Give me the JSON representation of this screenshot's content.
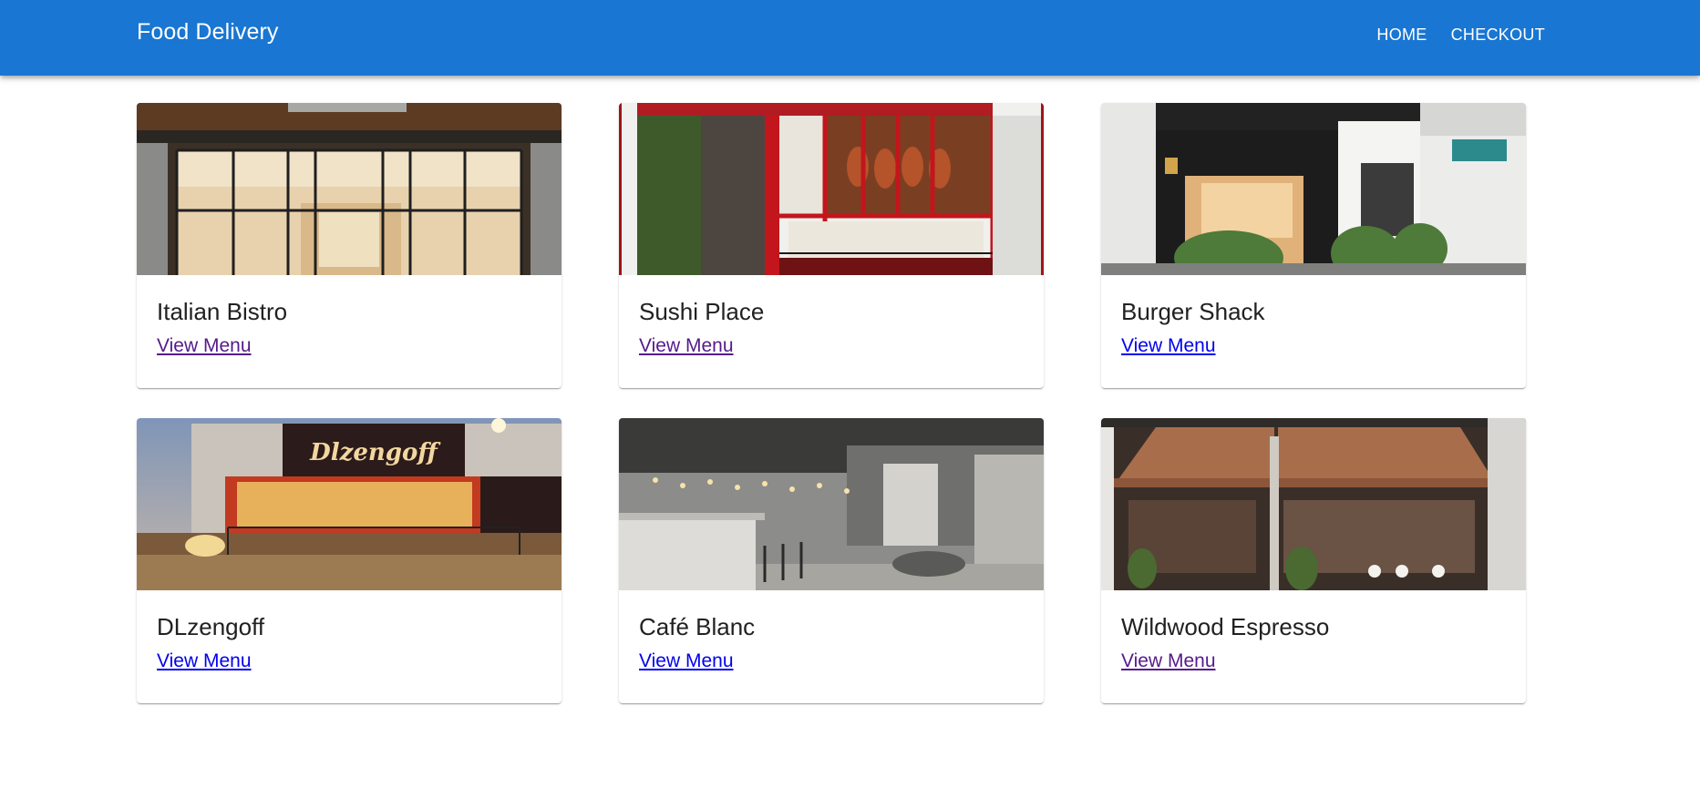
{
  "app": {
    "title": "Food Delivery",
    "accent_color": "#1976d2"
  },
  "nav": {
    "items": [
      {
        "label": "HOME"
      },
      {
        "label": "CHECKOUT"
      }
    ]
  },
  "restaurants": [
    {
      "name": "Italian Bistro",
      "link_label": "View Menu",
      "image": "storefront-photo"
    },
    {
      "name": "Sushi Place",
      "link_label": "View Menu",
      "image": "storefront-photo"
    },
    {
      "name": "Burger Shack",
      "link_label": "View Menu",
      "image": "storefront-photo"
    },
    {
      "name": "DLzengoff",
      "link_label": "View Menu",
      "image": "storefront-photo",
      "sign_text": "Dlzengoff"
    },
    {
      "name": "Café Blanc",
      "link_label": "View Menu",
      "image": "cafe-interior-photo"
    },
    {
      "name": "Wildwood Espresso",
      "link_label": "View Menu",
      "image": "storefront-photo"
    }
  ]
}
